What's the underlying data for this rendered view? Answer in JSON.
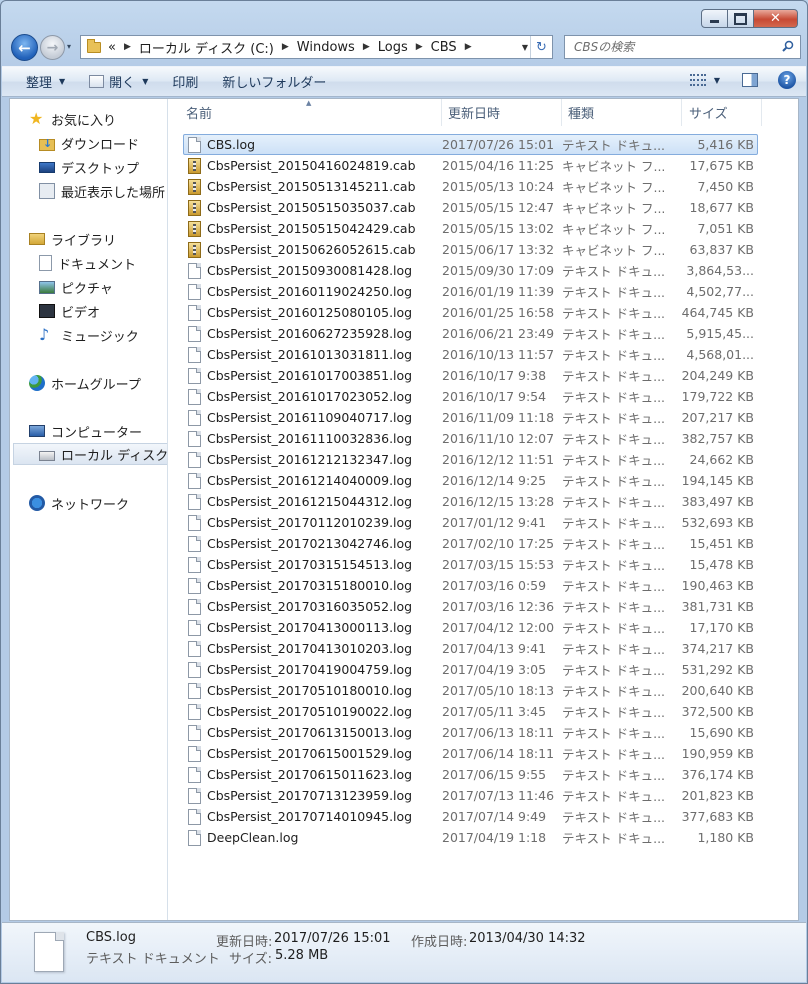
{
  "titlebar": {
    "min_icon": "minimize-icon",
    "max_icon": "maximize-icon",
    "close_glyph": "✕"
  },
  "nav": {
    "back_glyph": "←",
    "forward_glyph": "→",
    "recent_glyph": "▾",
    "crumbs": [
      "«",
      "ローカル ディスク (C:)",
      "Windows",
      "Logs",
      "CBS"
    ],
    "refresh_glyph": "↻",
    "search_placeholder": "CBSの検索"
  },
  "toolbar": {
    "organize": "整理",
    "open": "開く",
    "print": "印刷",
    "new_folder": "新しいフォルダー",
    "help": "?"
  },
  "navpane": {
    "favorites": {
      "label": "お気に入り",
      "items": [
        "ダウンロード",
        "デスクトップ",
        "最近表示した場所"
      ]
    },
    "libraries": {
      "label": "ライブラリ",
      "items": [
        "ドキュメント",
        "ピクチャ",
        "ビデオ",
        "ミュージック"
      ]
    },
    "homegroup": "ホームグループ",
    "computer": {
      "label": "コンピューター",
      "items": [
        "ローカル ディスク (C:)"
      ]
    },
    "network": "ネットワーク"
  },
  "columns": {
    "name": "名前",
    "date": "更新日時",
    "type": "種類",
    "size": "サイズ"
  },
  "files": [
    {
      "name": "CBS.log",
      "date": "2017/07/26 15:01",
      "type": "テキスト ドキュ...",
      "size": "5,416 KB",
      "kind": "log"
    },
    {
      "name": "CbsPersist_20150416024819.cab",
      "date": "2015/04/16 11:25",
      "type": "キャビネット フ...",
      "size": "17,675 KB",
      "kind": "cab"
    },
    {
      "name": "CbsPersist_20150513145211.cab",
      "date": "2015/05/13 10:24",
      "type": "キャビネット フ...",
      "size": "7,450 KB",
      "kind": "cab"
    },
    {
      "name": "CbsPersist_20150515035037.cab",
      "date": "2015/05/15 12:47",
      "type": "キャビネット フ...",
      "size": "18,677 KB",
      "kind": "cab"
    },
    {
      "name": "CbsPersist_20150515042429.cab",
      "date": "2015/05/15 13:02",
      "type": "キャビネット フ...",
      "size": "7,051 KB",
      "kind": "cab"
    },
    {
      "name": "CbsPersist_20150626052615.cab",
      "date": "2015/06/17 13:32",
      "type": "キャビネット フ...",
      "size": "63,837 KB",
      "kind": "cab"
    },
    {
      "name": "CbsPersist_20150930081428.log",
      "date": "2015/09/30 17:09",
      "type": "テキスト ドキュ...",
      "size": "3,864,53...",
      "kind": "log"
    },
    {
      "name": "CbsPersist_20160119024250.log",
      "date": "2016/01/19 11:39",
      "type": "テキスト ドキュ...",
      "size": "4,502,77...",
      "kind": "log"
    },
    {
      "name": "CbsPersist_20160125080105.log",
      "date": "2016/01/25 16:58",
      "type": "テキスト ドキュ...",
      "size": "464,745 KB",
      "kind": "log"
    },
    {
      "name": "CbsPersist_20160627235928.log",
      "date": "2016/06/21 23:49",
      "type": "テキスト ドキュ...",
      "size": "5,915,45...",
      "kind": "log"
    },
    {
      "name": "CbsPersist_20161013031811.log",
      "date": "2016/10/13 11:57",
      "type": "テキスト ドキュ...",
      "size": "4,568,01...",
      "kind": "log"
    },
    {
      "name": "CbsPersist_20161017003851.log",
      "date": "2016/10/17 9:38",
      "type": "テキスト ドキュ...",
      "size": "204,249 KB",
      "kind": "log"
    },
    {
      "name": "CbsPersist_20161017023052.log",
      "date": "2016/10/17 9:54",
      "type": "テキスト ドキュ...",
      "size": "179,722 KB",
      "kind": "log"
    },
    {
      "name": "CbsPersist_20161109040717.log",
      "date": "2016/11/09 11:18",
      "type": "テキスト ドキュ...",
      "size": "207,217 KB",
      "kind": "log"
    },
    {
      "name": "CbsPersist_20161110032836.log",
      "date": "2016/11/10 12:07",
      "type": "テキスト ドキュ...",
      "size": "382,757 KB",
      "kind": "log"
    },
    {
      "name": "CbsPersist_20161212132347.log",
      "date": "2016/12/12 11:51",
      "type": "テキスト ドキュ...",
      "size": "24,662 KB",
      "kind": "log"
    },
    {
      "name": "CbsPersist_20161214040009.log",
      "date": "2016/12/14 9:25",
      "type": "テキスト ドキュ...",
      "size": "194,145 KB",
      "kind": "log"
    },
    {
      "name": "CbsPersist_20161215044312.log",
      "date": "2016/12/15 13:28",
      "type": "テキスト ドキュ...",
      "size": "383,497 KB",
      "kind": "log"
    },
    {
      "name": "CbsPersist_20170112010239.log",
      "date": "2017/01/12 9:41",
      "type": "テキスト ドキュ...",
      "size": "532,693 KB",
      "kind": "log"
    },
    {
      "name": "CbsPersist_20170213042746.log",
      "date": "2017/02/10 17:25",
      "type": "テキスト ドキュ...",
      "size": "15,451 KB",
      "kind": "log"
    },
    {
      "name": "CbsPersist_20170315154513.log",
      "date": "2017/03/15 15:53",
      "type": "テキスト ドキュ...",
      "size": "15,478 KB",
      "kind": "log"
    },
    {
      "name": "CbsPersist_20170315180010.log",
      "date": "2017/03/16 0:59",
      "type": "テキスト ドキュ...",
      "size": "190,463 KB",
      "kind": "log"
    },
    {
      "name": "CbsPersist_20170316035052.log",
      "date": "2017/03/16 12:36",
      "type": "テキスト ドキュ...",
      "size": "381,731 KB",
      "kind": "log"
    },
    {
      "name": "CbsPersist_20170413000113.log",
      "date": "2017/04/12 12:00",
      "type": "テキスト ドキュ...",
      "size": "17,170 KB",
      "kind": "log"
    },
    {
      "name": "CbsPersist_20170413010203.log",
      "date": "2017/04/13 9:41",
      "type": "テキスト ドキュ...",
      "size": "374,217 KB",
      "kind": "log"
    },
    {
      "name": "CbsPersist_20170419004759.log",
      "date": "2017/04/19 3:05",
      "type": "テキスト ドキュ...",
      "size": "531,292 KB",
      "kind": "log"
    },
    {
      "name": "CbsPersist_20170510180010.log",
      "date": "2017/05/10 18:13",
      "type": "テキスト ドキュ...",
      "size": "200,640 KB",
      "kind": "log"
    },
    {
      "name": "CbsPersist_20170510190022.log",
      "date": "2017/05/11 3:45",
      "type": "テキスト ドキュ...",
      "size": "372,500 KB",
      "kind": "log"
    },
    {
      "name": "CbsPersist_20170613150013.log",
      "date": "2017/06/13 18:11",
      "type": "テキスト ドキュ...",
      "size": "15,690 KB",
      "kind": "log"
    },
    {
      "name": "CbsPersist_20170615001529.log",
      "date": "2017/06/14 18:11",
      "type": "テキスト ドキュ...",
      "size": "190,959 KB",
      "kind": "log"
    },
    {
      "name": "CbsPersist_20170615011623.log",
      "date": "2017/06/15 9:55",
      "type": "テキスト ドキュ...",
      "size": "376,174 KB",
      "kind": "log"
    },
    {
      "name": "CbsPersist_20170713123959.log",
      "date": "2017/07/13 11:46",
      "type": "テキスト ドキュ...",
      "size": "201,823 KB",
      "kind": "log"
    },
    {
      "name": "CbsPersist_20170714010945.log",
      "date": "2017/07/14 9:49",
      "type": "テキスト ドキュ...",
      "size": "377,683 KB",
      "kind": "log"
    },
    {
      "name": "DeepClean.log",
      "date": "2017/04/19 1:18",
      "type": "テキスト ドキュ...",
      "size": "1,180 KB",
      "kind": "log"
    }
  ],
  "details": {
    "name": "CBS.log",
    "type": "テキスト ドキュメント",
    "modified_label": "更新日時:",
    "modified_value": "2017/07/26 15:01",
    "created_label": "作成日時:",
    "created_value": "2013/04/30 14:32",
    "size_label": "サイズ:",
    "size_value": "5.28 MB"
  }
}
